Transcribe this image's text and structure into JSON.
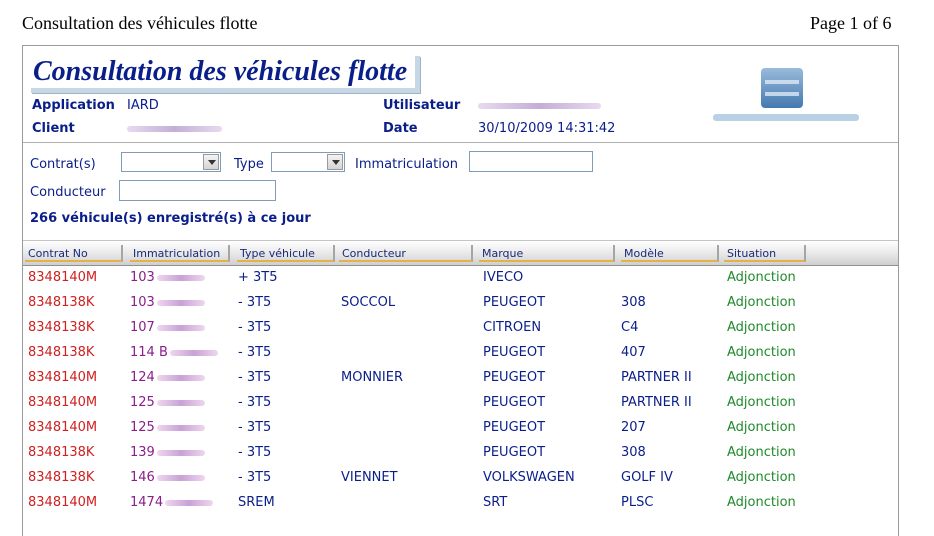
{
  "print_header": {
    "title": "Consultation des véhicules flotte",
    "page": "Page 1 of 6"
  },
  "banner": {
    "title": "Consultation des véhicules flotte"
  },
  "info": {
    "application_label": "Application",
    "application_value": "IARD",
    "client_label": "Client",
    "utilisateur_label": "Utilisateur",
    "date_label": "Date",
    "date_value": "30/10/2009 14:31:42"
  },
  "filters": {
    "contrat_label": "Contrat(s)",
    "type_label": "Type",
    "immat_label": "Immatriculation",
    "conducteur_label": "Conducteur"
  },
  "count_text": "266 véhicule(s) enregistré(s) à ce jour",
  "columns": [
    "Contrat No",
    "Immatriculation",
    "Type véhicule",
    "Conducteur",
    "Marque",
    "Modèle",
    "Situation"
  ],
  "rows": [
    {
      "contrat": "8348140M",
      "immat": "103",
      "type": "+ 3T5",
      "conducteur": "",
      "marque": "IVECO",
      "modele": "",
      "situation": "Adjonction"
    },
    {
      "contrat": "8348138K",
      "immat": "103",
      "type": "- 3T5",
      "conducteur": "SOCCOL",
      "marque": "PEUGEOT",
      "modele": "308",
      "situation": "Adjonction"
    },
    {
      "contrat": "8348138K",
      "immat": "107",
      "type": "- 3T5",
      "conducteur": "",
      "marque": "CITROEN",
      "modele": "C4",
      "situation": "Adjonction"
    },
    {
      "contrat": "8348138K",
      "immat": "114 B",
      "type": "- 3T5",
      "conducteur": "",
      "marque": "PEUGEOT",
      "modele": "407",
      "situation": "Adjonction"
    },
    {
      "contrat": "8348140M",
      "immat": "124",
      "type": "- 3T5",
      "conducteur": "MONNIER",
      "marque": "PEUGEOT",
      "modele": "PARTNER II",
      "situation": "Adjonction"
    },
    {
      "contrat": "8348140M",
      "immat": "125",
      "type": "- 3T5",
      "conducteur": "",
      "marque": "PEUGEOT",
      "modele": "PARTNER II",
      "situation": "Adjonction"
    },
    {
      "contrat": "8348140M",
      "immat": "125",
      "type": "- 3T5",
      "conducteur": "",
      "marque": "PEUGEOT",
      "modele": "207",
      "situation": "Adjonction"
    },
    {
      "contrat": "8348138K",
      "immat": "139",
      "type": "- 3T5",
      "conducteur": "",
      "marque": "PEUGEOT",
      "modele": "308",
      "situation": "Adjonction"
    },
    {
      "contrat": "8348138K",
      "immat": "146",
      "type": "- 3T5",
      "conducteur": "VIENNET",
      "marque": "VOLKSWAGEN",
      "modele": "GOLF IV",
      "situation": "Adjonction"
    },
    {
      "contrat": "8348140M",
      "immat": "1474",
      "type": "SREM",
      "conducteur": "",
      "marque": "SRT",
      "modele": "PLSC",
      "situation": "Adjonction"
    }
  ]
}
